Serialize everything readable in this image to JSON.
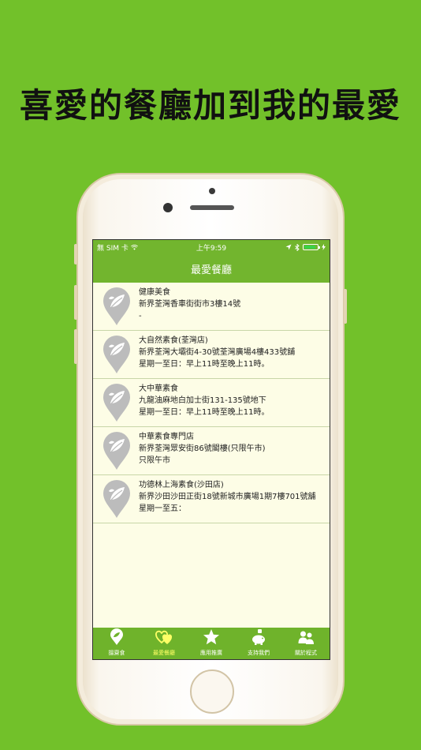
{
  "headline": "喜愛的餐廳加到我的最愛",
  "statusbar": {
    "carrier": "無 SIM 卡",
    "time": "上午9:59",
    "battery_level": 0.9
  },
  "navbar": {
    "title": "最愛餐廳"
  },
  "restaurants": [
    {
      "name": "健康美食",
      "address": "新界荃灣香車街街市3樓14號",
      "hours": "-"
    },
    {
      "name": "大自然素食(荃灣店)",
      "address": "新界荃灣大壩街4-30號荃灣廣場4樓433號舖",
      "hours": "星期一至日：早上11時至晚上11時。"
    },
    {
      "name": "大中華素食",
      "address": "九龍油麻地白加士街131-135號地下",
      "hours": "星期一至日：早上11時至晚上11時。"
    },
    {
      "name": "中華素食專門店",
      "address": "新界荃灣眾安街86號閣樓(只限午市)",
      "hours": "只限午市"
    },
    {
      "name": "功德林上海素食(沙田店)",
      "address": "新界沙田沙田正街18號新城市廣場1期7樓701號舖",
      "hours": "星期一至五："
    }
  ],
  "tabs": [
    {
      "label": "搵齋食",
      "icon": "leaf-pin-icon",
      "active": false
    },
    {
      "label": "最愛餐廳",
      "icon": "hearts-icon",
      "active": true
    },
    {
      "label": "應用推廣",
      "icon": "star-icon",
      "active": false
    },
    {
      "label": "支持我們",
      "icon": "piggy-bank-icon",
      "active": false
    },
    {
      "label": "關於程式",
      "icon": "people-icon",
      "active": false
    }
  ],
  "colors": {
    "background": "#72c12a",
    "bar": "#72b52e",
    "list_bg": "#fdfde6",
    "active_tab": "#ffff66"
  }
}
